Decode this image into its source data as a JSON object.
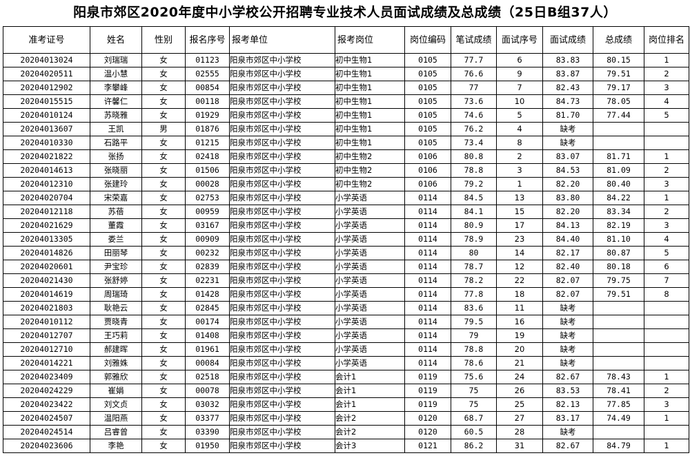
{
  "title": "阳泉市郊区2020年度中小学校公开招聘专业技术人员面试成绩及总成绩（25日B组37人）",
  "headers": [
    "准考证号",
    "姓名",
    "性别",
    "报名序号",
    "报考单位",
    "报考岗位",
    "岗位编码",
    "笔试成绩",
    "面试序号",
    "面试成绩",
    "总成绩",
    "岗位排名"
  ],
  "rows": [
    [
      "20204013024",
      "刘瑞瑞",
      "女",
      "01123",
      "阳泉市郊区中小学校",
      "初中生物1",
      "0105",
      "77.7",
      "6",
      "83.83",
      "80.15",
      "1"
    ],
    [
      "20204020511",
      "温小慧",
      "女",
      "02555",
      "阳泉市郊区中小学校",
      "初中生物1",
      "0105",
      "76.6",
      "9",
      "83.87",
      "79.51",
      "2"
    ],
    [
      "20204012902",
      "李攀峰",
      "女",
      "00854",
      "阳泉市郊区中小学校",
      "初中生物1",
      "0105",
      "77",
      "7",
      "82.43",
      "79.17",
      "3"
    ],
    [
      "20204015515",
      "许馨仁",
      "女",
      "00118",
      "阳泉市郊区中小学校",
      "初中生物1",
      "0105",
      "73.6",
      "10",
      "84.73",
      "78.05",
      "4"
    ],
    [
      "20204010124",
      "苏晓雅",
      "女",
      "01929",
      "阳泉市郊区中小学校",
      "初中生物1",
      "0105",
      "74.6",
      "5",
      "81.70",
      "77.44",
      "5"
    ],
    [
      "20204013607",
      "王凯",
      "男",
      "01876",
      "阳泉市郊区中小学校",
      "初中生物1",
      "0105",
      "76.2",
      "4",
      "缺考",
      "",
      ""
    ],
    [
      "20204010330",
      "石路平",
      "女",
      "01215",
      "阳泉市郊区中小学校",
      "初中生物1",
      "0105",
      "73.4",
      "8",
      "缺考",
      "",
      ""
    ],
    [
      "20204021822",
      "张扬",
      "女",
      "02418",
      "阳泉市郊区中小学校",
      "初中生物2",
      "0106",
      "80.8",
      "2",
      "83.07",
      "81.71",
      "1"
    ],
    [
      "20204014613",
      "张晓丽",
      "女",
      "01506",
      "阳泉市郊区中小学校",
      "初中生物2",
      "0106",
      "78.8",
      "3",
      "84.53",
      "81.09",
      "2"
    ],
    [
      "20204012310",
      "张建玲",
      "女",
      "00028",
      "阳泉市郊区中小学校",
      "初中生物2",
      "0106",
      "79.2",
      "1",
      "82.20",
      "80.40",
      "3"
    ],
    [
      "20204020704",
      "宋荣嘉",
      "女",
      "02753",
      "阳泉市郊区中小学校",
      "小学英语",
      "0114",
      "84.5",
      "13",
      "83.80",
      "84.22",
      "1"
    ],
    [
      "20204012118",
      "苏蓓",
      "女",
      "00959",
      "阳泉市郊区中小学校",
      "小学英语",
      "0114",
      "84.1",
      "15",
      "82.20",
      "83.34",
      "2"
    ],
    [
      "20204021629",
      "董霞",
      "女",
      "03167",
      "阳泉市郊区中小学校",
      "小学英语",
      "0114",
      "80.9",
      "17",
      "84.13",
      "82.19",
      "3"
    ],
    [
      "20204013305",
      "娄兰",
      "女",
      "00909",
      "阳泉市郊区中小学校",
      "小学英语",
      "0114",
      "78.9",
      "23",
      "84.40",
      "81.10",
      "4"
    ],
    [
      "20204014826",
      "田丽琴",
      "女",
      "00232",
      "阳泉市郊区中小学校",
      "小学英语",
      "0114",
      "80",
      "14",
      "82.17",
      "80.87",
      "5"
    ],
    [
      "20204020601",
      "尹宝珍",
      "女",
      "02839",
      "阳泉市郊区中小学校",
      "小学英语",
      "0114",
      "78.7",
      "12",
      "82.40",
      "80.18",
      "6"
    ],
    [
      "20204021430",
      "张舒婷",
      "女",
      "02231",
      "阳泉市郊区中小学校",
      "小学英语",
      "0114",
      "78.2",
      "22",
      "82.07",
      "79.75",
      "7"
    ],
    [
      "20204014619",
      "周瑞琦",
      "女",
      "01428",
      "阳泉市郊区中小学校",
      "小学英语",
      "0114",
      "77.8",
      "18",
      "82.07",
      "79.51",
      "8"
    ],
    [
      "20204021803",
      "耿艳云",
      "女",
      "02845",
      "阳泉市郊区中小学校",
      "小学英语",
      "0114",
      "83.6",
      "11",
      "缺考",
      "",
      ""
    ],
    [
      "20204010112",
      "贾晓青",
      "女",
      "00174",
      "阳泉市郊区中小学校",
      "小学英语",
      "0114",
      "79.5",
      "16",
      "缺考",
      "",
      ""
    ],
    [
      "20204012707",
      "王巧莉",
      "女",
      "01408",
      "阳泉市郊区中小学校",
      "小学英语",
      "0114",
      "79",
      "19",
      "缺考",
      "",
      ""
    ],
    [
      "20204012710",
      "郝建晖",
      "女",
      "01961",
      "阳泉市郊区中小学校",
      "小学英语",
      "0114",
      "78.8",
      "20",
      "缺考",
      "",
      ""
    ],
    [
      "20204014221",
      "刘雅姝",
      "女",
      "00084",
      "阳泉市郊区中小学校",
      "小学英语",
      "0114",
      "78.6",
      "21",
      "缺考",
      "",
      ""
    ],
    [
      "20204023409",
      "郭雅欣",
      "女",
      "02518",
      "阳泉市郊区中小学校",
      "会计1",
      "0119",
      "75.6",
      "24",
      "82.67",
      "78.43",
      "1"
    ],
    [
      "20204024229",
      "崔娟",
      "女",
      "00078",
      "阳泉市郊区中小学校",
      "会计1",
      "0119",
      "75",
      "26",
      "83.53",
      "78.41",
      "2"
    ],
    [
      "20204023422",
      "刘文贞",
      "女",
      "03032",
      "阳泉市郊区中小学校",
      "会计1",
      "0119",
      "75",
      "25",
      "82.13",
      "77.85",
      "3"
    ],
    [
      "20204024507",
      "温阳燕",
      "女",
      "03377",
      "阳泉市郊区中小学校",
      "会计2",
      "0120",
      "68.7",
      "27",
      "83.17",
      "74.49",
      "1"
    ],
    [
      "20204024514",
      "吕睿曾",
      "女",
      "03390",
      "阳泉市郊区中小学校",
      "会计2",
      "0120",
      "60.5",
      "28",
      "缺考",
      "",
      ""
    ],
    [
      "20204023606",
      "李艳",
      "女",
      "01950",
      "阳泉市郊区中小学校",
      "会计3",
      "0121",
      "86.2",
      "31",
      "82.67",
      "84.79",
      "1"
    ]
  ]
}
